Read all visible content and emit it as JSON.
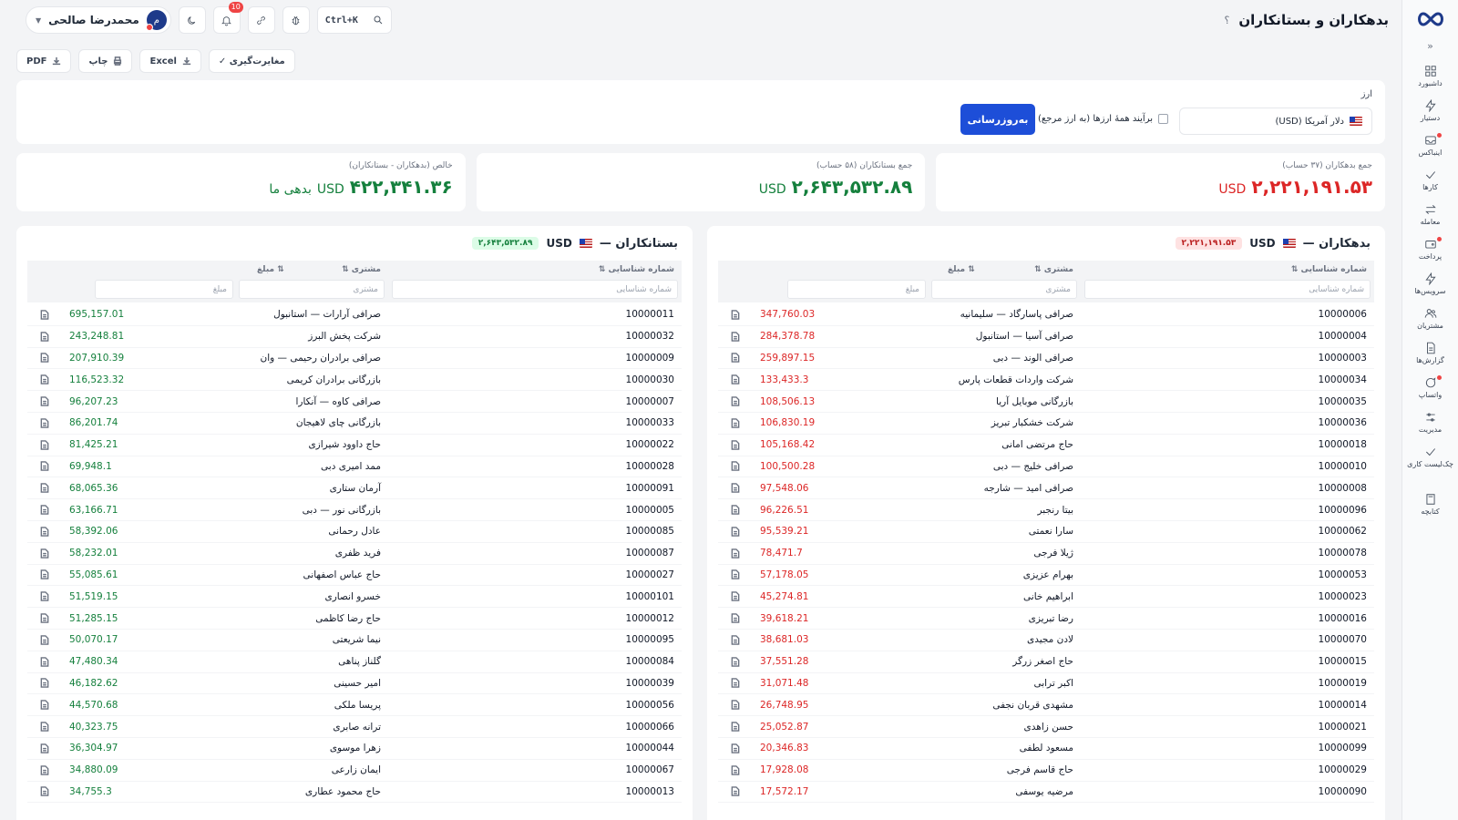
{
  "header": {
    "title": "بدهکاران و بستانکاران",
    "help": "؟",
    "search_shortcut": "Ctrl+K",
    "notif_count": "10",
    "user_name": "محمدرضا صالحی",
    "user_initial": "م"
  },
  "sidebar": {
    "items": [
      {
        "label": "داشبورد",
        "icon": "dashboard-icon"
      },
      {
        "label": "دستیار",
        "icon": "bolt-icon"
      },
      {
        "label": "اینباکس",
        "icon": "inbox-icon",
        "dot": true
      },
      {
        "label": "کارها",
        "icon": "check-icon"
      },
      {
        "label": "معامله",
        "icon": "swap-icon"
      },
      {
        "label": "پرداخت",
        "icon": "wallet-icon",
        "dot": true
      },
      {
        "label": "سرویس‌ها",
        "icon": "service-icon"
      },
      {
        "label": "مشتریان",
        "icon": "users-icon"
      },
      {
        "label": "گزارش‌ها",
        "icon": "report-icon"
      },
      {
        "label": "واتساپ",
        "icon": "chat-icon",
        "dot": true
      },
      {
        "label": "مدیریت",
        "icon": "settings-icon"
      },
      {
        "label": "چک‌لیست کاری",
        "icon": "checklist-icon"
      },
      {
        "label": "کتابچه",
        "icon": "book-icon"
      }
    ]
  },
  "toolbar": {
    "pdf": "PDF",
    "print": "چاپ",
    "excel": "Excel",
    "reconcile": "✓ مغایرت‌گیری"
  },
  "filter": {
    "label": "ارز",
    "currency": "دلار آمریکا (USD)",
    "all_currencies": "برآیند همهٔ ارزها (به ارز مرجع)",
    "update": "به‌روزرسانی"
  },
  "summary": {
    "debtors_caption": "جمع بدهکاران (۳۷ حساب)",
    "debtors_value": "۲,۲۲۱,۱۹۱.۵۳",
    "creditors_caption": "جمع بستانکاران (۵۸ حساب)",
    "creditors_value": "۲,۶۴۳,۵۳۲.۸۹",
    "net_caption": "خالص (بدهکاران - بستانکاران)",
    "net_value": "۴۲۲,۳۴۱.۳۶",
    "net_suffix": "بدهی ما",
    "currency": "USD"
  },
  "columns": {
    "id": "شماره شناسایی ⇅",
    "customer": "مشتری ⇅",
    "amount": "⇅ مبلغ",
    "id_placeholder": "شماره شناسایی",
    "customer_placeholder": "مشتری",
    "amount_placeholder": "مبلغ"
  },
  "debtors": {
    "title": "بدهکاران —",
    "currency": "USD",
    "total": "۲,۲۲۱,۱۹۱.۵۳",
    "rows": [
      {
        "id": "10000006",
        "name": "صرافی پاسارگاد — سلیمانیه",
        "amount": "347,760.03"
      },
      {
        "id": "10000004",
        "name": "صرافی آسیا — استانبول",
        "amount": "284,378.78"
      },
      {
        "id": "10000003",
        "name": "صرافی الوند — دبی",
        "amount": "259,897.15"
      },
      {
        "id": "10000034",
        "name": "شرکت واردات قطعات پارس",
        "amount": "133,433.3"
      },
      {
        "id": "10000035",
        "name": "بازرگانی موبایل آریا",
        "amount": "108,506.13"
      },
      {
        "id": "10000036",
        "name": "شرکت خشکبار تبریز",
        "amount": "106,830.19"
      },
      {
        "id": "10000018",
        "name": "حاج مرتضی امانی",
        "amount": "105,168.42"
      },
      {
        "id": "10000010",
        "name": "صرافی خلیج — دبی",
        "amount": "100,500.28"
      },
      {
        "id": "10000008",
        "name": "صرافی امید — شارجه",
        "amount": "97,548.06"
      },
      {
        "id": "10000096",
        "name": "بیتا رنجبر",
        "amount": "96,226.51"
      },
      {
        "id": "10000062",
        "name": "سارا نعمتی",
        "amount": "95,539.21"
      },
      {
        "id": "10000078",
        "name": "ژیلا فرجی",
        "amount": "78,471.7"
      },
      {
        "id": "10000053",
        "name": "بهرام عزیزی",
        "amount": "57,178.05"
      },
      {
        "id": "10000023",
        "name": "ابراهیم خانی",
        "amount": "45,274.81"
      },
      {
        "id": "10000016",
        "name": "رضا تبریزی",
        "amount": "39,618.21"
      },
      {
        "id": "10000070",
        "name": "لادن مجیدی",
        "amount": "38,681.03"
      },
      {
        "id": "10000015",
        "name": "حاج اصغر زرگر",
        "amount": "37,551.28"
      },
      {
        "id": "10000019",
        "name": "اکبر ترابی",
        "amount": "31,071.48"
      },
      {
        "id": "10000014",
        "name": "مشهدی قربان نجفی",
        "amount": "26,748.95"
      },
      {
        "id": "10000021",
        "name": "حسن زاهدی",
        "amount": "25,052.87"
      },
      {
        "id": "10000099",
        "name": "مسعود لطفی",
        "amount": "20,346.83"
      },
      {
        "id": "10000029",
        "name": "حاج قاسم فرجی",
        "amount": "17,928.08"
      },
      {
        "id": "10000090",
        "name": "مرضیه یوسفی",
        "amount": "17,572.17"
      }
    ]
  },
  "creditors": {
    "title": "بستانکاران —",
    "currency": "USD",
    "total": "۲,۶۴۳,۵۳۲.۸۹",
    "rows": [
      {
        "id": "10000011",
        "name": "صرافی آرارات — استانبول",
        "amount": "695,157.01"
      },
      {
        "id": "10000032",
        "name": "شرکت پخش البرز",
        "amount": "243,248.81"
      },
      {
        "id": "10000009",
        "name": "صرافی برادران رحیمی — وان",
        "amount": "207,910.39"
      },
      {
        "id": "10000030",
        "name": "بازرگانی برادران کریمی",
        "amount": "116,523.32"
      },
      {
        "id": "10000007",
        "name": "صرافی کاوه — آنکارا",
        "amount": "96,207.23"
      },
      {
        "id": "10000033",
        "name": "بازرگانی چای لاهیجان",
        "amount": "86,201.74"
      },
      {
        "id": "10000022",
        "name": "حاج داوود شیرازی",
        "amount": "81,425.21"
      },
      {
        "id": "10000028",
        "name": "ممد امیری دبی",
        "amount": "69,948.1"
      },
      {
        "id": "10000091",
        "name": "آرمان ستاری",
        "amount": "68,065.36"
      },
      {
        "id": "10000005",
        "name": "بازرگانی نور — دبی",
        "amount": "63,166.71"
      },
      {
        "id": "10000085",
        "name": "عادل رحمانی",
        "amount": "58,392.06"
      },
      {
        "id": "10000087",
        "name": "فرید ظفری",
        "amount": "58,232.01"
      },
      {
        "id": "10000027",
        "name": "حاج عباس اصفهانی",
        "amount": "55,085.61"
      },
      {
        "id": "10000101",
        "name": "خسرو انصاری",
        "amount": "51,519.15"
      },
      {
        "id": "10000012",
        "name": "حاج رضا کاظمی",
        "amount": "51,285.15"
      },
      {
        "id": "10000095",
        "name": "نیما شریعتی",
        "amount": "50,070.17"
      },
      {
        "id": "10000084",
        "name": "گلناز پناهی",
        "amount": "47,480.34"
      },
      {
        "id": "10000039",
        "name": "امیر حسینی",
        "amount": "46,182.62"
      },
      {
        "id": "10000056",
        "name": "پریسا ملکی",
        "amount": "44,570.68"
      },
      {
        "id": "10000066",
        "name": "ترانه صابری",
        "amount": "40,323.75"
      },
      {
        "id": "10000044",
        "name": "زهرا موسوی",
        "amount": "36,304.97"
      },
      {
        "id": "10000067",
        "name": "ایمان زارعی",
        "amount": "34,880.09"
      },
      {
        "id": "10000013",
        "name": "حاج محمود عطاری",
        "amount": "34,755.3"
      }
    ]
  },
  "colors": {
    "accent": "#1d4ed8",
    "debt": "#dc2626",
    "credit": "#15803d"
  }
}
